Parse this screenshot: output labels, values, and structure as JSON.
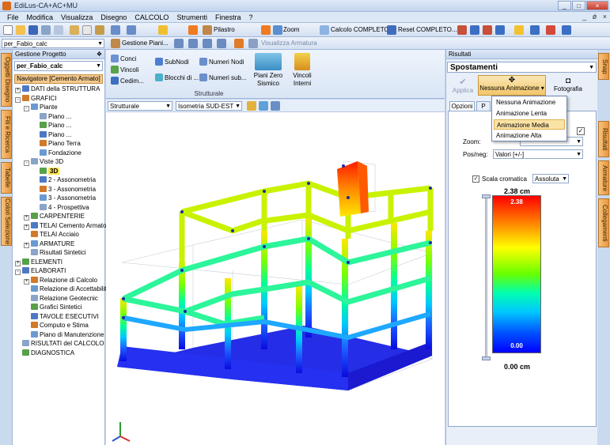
{
  "window": {
    "title": "EdiLus-CA+AC+MU"
  },
  "menu": {
    "items": [
      "File",
      "Modifica",
      "Visualizza",
      "Disegno",
      "CALCOLO",
      "Strumenti",
      "Finestra",
      "?"
    ],
    "right": "_   ǿ   ×"
  },
  "toolbar": {
    "pilastro": "Pilastro",
    "zoom": "Zoom",
    "calcolo": "Calcolo COMPLETO...",
    "reset": "Reset COMPLETO..."
  },
  "toolbar2": {
    "project_combo": "per_Fabio_calc",
    "gestione_piani": "Gestione Piani...",
    "visualizza_armatura": "Visualizza Armatura"
  },
  "left_tabs": [
    "Oggetti Disegno",
    "Fili e Ricerca",
    "Tabelle",
    "Colori Selezione"
  ],
  "project_panel": {
    "header": "Gestione Progetto",
    "pin": "❖",
    "project": "per_Fabio_calc",
    "navigator": "Navigatore [Cemento Armato]",
    "tree": [
      {
        "label": "DATI della STRUTTURA",
        "indent": 0,
        "pm": "+"
      },
      {
        "label": "GRAFICI",
        "indent": 0,
        "pm": "-"
      },
      {
        "label": "Piante",
        "indent": 1,
        "pm": "-"
      },
      {
        "label": "Piano ...",
        "indent": 2,
        "pm": ""
      },
      {
        "label": "Piano ...",
        "indent": 2,
        "pm": ""
      },
      {
        "label": "Piano ...",
        "indent": 2,
        "pm": ""
      },
      {
        "label": "Piano Terra",
        "indent": 2,
        "pm": ""
      },
      {
        "label": "Fondazione",
        "indent": 2,
        "pm": ""
      },
      {
        "label": "Viste 3D",
        "indent": 1,
        "pm": "-"
      },
      {
        "label": "3D",
        "indent": 2,
        "pm": "",
        "selected": true
      },
      {
        "label": "2 - Assonometria",
        "indent": 2,
        "pm": ""
      },
      {
        "label": "3 - Assonometria",
        "indent": 2,
        "pm": ""
      },
      {
        "label": "3 - Assonometria",
        "indent": 2,
        "pm": ""
      },
      {
        "label": "4 - Prospettiva",
        "indent": 2,
        "pm": ""
      },
      {
        "label": "CARPENTERIE",
        "indent": 1,
        "pm": "+"
      },
      {
        "label": "TELAI Cemento Armato",
        "indent": 1,
        "pm": "+"
      },
      {
        "label": "TELAI Acciaio",
        "indent": 1,
        "pm": ""
      },
      {
        "label": "ARMATURE",
        "indent": 1,
        "pm": "+"
      },
      {
        "label": "Risultati Sintetici",
        "indent": 1,
        "pm": ""
      },
      {
        "label": "ELEMENTI",
        "indent": 0,
        "pm": "+"
      },
      {
        "label": "ELABORATI",
        "indent": 0,
        "pm": "-"
      },
      {
        "label": "Relazione di Calcolo",
        "indent": 1,
        "pm": "+"
      },
      {
        "label": "Relazione di Accettabilit",
        "indent": 1,
        "pm": ""
      },
      {
        "label": "Relazione Geotecnic",
        "indent": 1,
        "pm": ""
      },
      {
        "label": "Grafici Sintetici",
        "indent": 1,
        "pm": ""
      },
      {
        "label": "TAVOLE ESECUTIVI",
        "indent": 1,
        "pm": ""
      },
      {
        "label": "Computo e Stima",
        "indent": 1,
        "pm": ""
      },
      {
        "label": "Piano di Manutenzione",
        "indent": 1,
        "pm": ""
      },
      {
        "label": "RISULTATI del CALCOLO",
        "indent": 0,
        "pm": ""
      },
      {
        "label": "DIAGNOSTICA",
        "indent": 0,
        "pm": ""
      }
    ]
  },
  "ribbon": {
    "conci": "Conci",
    "vincoli": "Vincoli",
    "cedim": "Cedim...",
    "subnodi": "SubNodi",
    "blocchi": "Blocchi di ...",
    "numeri_nodi": "Numeri Nodi",
    "numeri_sub": "Numeri sub...",
    "piani_zero": "Piani Zero",
    "sismico": "Sismico",
    "vincoli_interni": "Vincoli",
    "interni": "Interni",
    "group": "Strutturale"
  },
  "view_toolbar": {
    "combo1": "Strutturale",
    "combo2": "Isometria SUD-EST"
  },
  "results_panel": {
    "header": "Risultati",
    "type": "Spostamenti",
    "applica": "Applica",
    "nessuna_animazione": "Nessuna Animazione",
    "fotografia": "Fotografia",
    "tab_opzioni": "Opzioni",
    "tab_p": "P",
    "zoom_label": "Zoom:",
    "posneg_label": "Pos/neg:",
    "posneg_value": "Valori  [+/-]",
    "scala_label": "Scala cromatica",
    "scala_value": "Assoluta",
    "max_label": "2.38 cm",
    "max_inner": "2.38",
    "min_inner": "0.00",
    "min_label": "0.00 cm"
  },
  "animation_menu": {
    "options": [
      "Nessuna Animazione",
      "Animazione Lenta",
      "Animazione Media",
      "Animazione Alta"
    ],
    "highlighted": "Animazione Media"
  },
  "right_tabs": [
    "Snap",
    "Risultati",
    "Armature",
    "Collegamenti"
  ]
}
